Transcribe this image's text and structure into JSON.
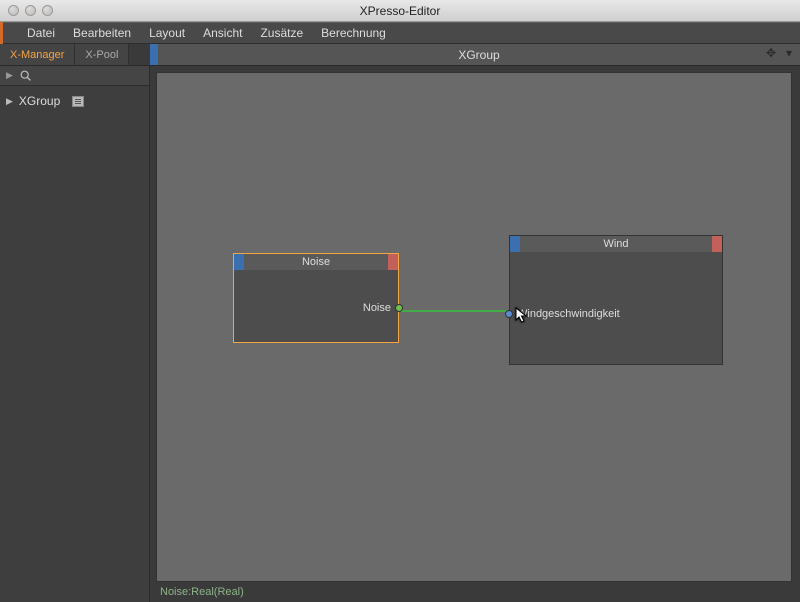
{
  "window": {
    "title": "XPresso-Editor"
  },
  "menu": {
    "items": [
      "Datei",
      "Bearbeiten",
      "Layout",
      "Ansicht",
      "Zusätze",
      "Berechnung"
    ]
  },
  "tabs": {
    "items": [
      {
        "label": "X-Manager",
        "active": true
      },
      {
        "label": "X-Pool",
        "active": false
      }
    ]
  },
  "canvas": {
    "title": "XGroup"
  },
  "sidebar": {
    "tree": [
      {
        "label": "XGroup"
      }
    ]
  },
  "nodes": {
    "noise": {
      "title": "Noise",
      "outputs": [
        {
          "label": "Noise",
          "color": "#6fbf4a"
        }
      ]
    },
    "wind": {
      "title": "Wind",
      "inputs": [
        {
          "label": "Windgeschwindigkeit",
          "color": "#5a8bd0"
        }
      ]
    }
  },
  "status": {
    "text": "Noise:Real(Real)"
  },
  "wire": {
    "color": "#35c23a"
  },
  "icons": {
    "move": "✥",
    "down": "▾"
  }
}
